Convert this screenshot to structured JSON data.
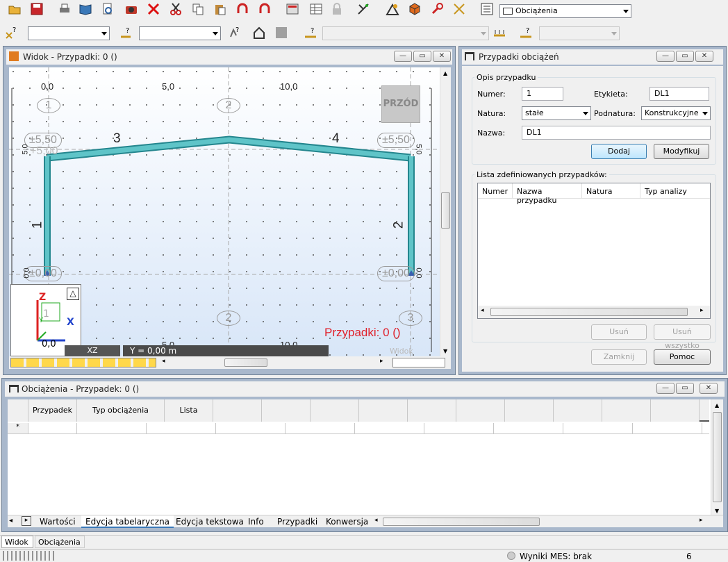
{
  "toolbar1": {
    "icons": [
      "open-icon",
      "save-icon",
      "print-icon",
      "book-icon",
      "print-preview-icon",
      "camera-icon",
      "delete-icon",
      "cut-icon",
      "copy-icon",
      "paste-icon",
      "undo-icon",
      "redo-icon",
      "calculator-icon",
      "table-icon",
      "lock-icon",
      "nodes-icon",
      "structure-icon",
      "cube-icon",
      "wrench-icon",
      "measure-icon",
      "layout-icon"
    ],
    "layout_combo": "Obciążenia"
  },
  "toolbar2": {
    "combo1": "",
    "combo2": "",
    "combo3": "",
    "combo4": ""
  },
  "view_window": {
    "title": "Widok - Przypadki: 0 ()",
    "axis_top": [
      "0,0",
      "5,0",
      "10,0"
    ],
    "axis_bottom": [
      "0,0",
      "5,0",
      "10,0"
    ],
    "nodes_top": [
      "1",
      "2"
    ],
    "nodes_bottom": [
      "1",
      "2",
      "3"
    ],
    "levels": [
      "±5,50",
      "±5,50",
      "±0,00",
      "±0,00"
    ],
    "level_overlap": "+5,00",
    "member_labels": [
      "3",
      "4",
      "1",
      "2"
    ],
    "side_values": [
      "5,0",
      "5,0",
      "0,0",
      "0,0"
    ],
    "cube_label": "PRZÓD",
    "cases_label": "Przypadki: 0 ()",
    "plane_label": "XZ",
    "coord_label": "Y = 0,00 m",
    "view_label": "Widok",
    "axis_z": "Z",
    "axis_x": "X",
    "axis_y": "Y"
  },
  "cases_panel": {
    "title": "Przypadki obciążeń",
    "group_desc": "Opis przypadku",
    "numer_label": "Numer:",
    "numer_value": "1",
    "etykieta_label": "Etykieta:",
    "etykieta_value": "DL1",
    "natura_label": "Natura:",
    "natura_value": "stałe",
    "podnatura_label": "Podnatura:",
    "podnatura_value": "Konstrukcyjne",
    "nazwa_label": "Nazwa:",
    "nazwa_value": "DL1",
    "add_btn": "Dodaj",
    "modify_btn": "Modyfikuj",
    "list_label": "Lista zdefiniowanych przypadków:",
    "columns": [
      "Numer",
      "Nazwa przypadku",
      "Natura",
      "Typ analizy"
    ],
    "delete_btn": "Usuń",
    "delete_all_btn": "Usuń wszystko",
    "close_btn": "Zamknij",
    "help_btn": "Pomoc"
  },
  "loads_window": {
    "title": "Obciążenia - Przypadek: 0 ()",
    "columns": [
      "Przypadek",
      "Typ obciążenia",
      "Lista"
    ],
    "new_row_marker": "*",
    "tabs": [
      "Wartości",
      "Edycja tabelaryczna",
      "Edycja tekstowa",
      "Info",
      "Przypadki",
      "Konwersja"
    ]
  },
  "bottom_tabs": [
    "Widok",
    "Obciążenia"
  ],
  "status": {
    "mes": "Wyniki MES: brak",
    "num": "6"
  }
}
